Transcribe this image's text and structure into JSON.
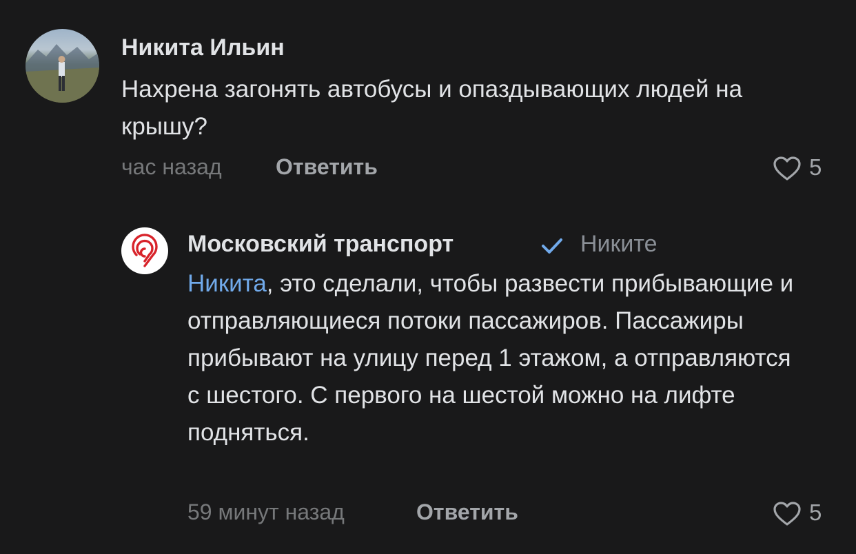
{
  "comments": [
    {
      "author": "Никита Ильин",
      "text": "Нахрена загонять автобусы и опаздывающих людей на крышу?",
      "time": "час назад",
      "reply_label": "Ответить",
      "likes": "5"
    },
    {
      "author": "Московский транспорт",
      "verified": true,
      "reply_to": "Никите",
      "mention": "Никита",
      "text": ", это сделали, чтобы развести прибывающие и отправляющиеся потоки пассажиров. Пассажиры прибывают на улицу перед 1 этажом, а отправляются с шестого. С первого на шестой можно на лифте подняться.",
      "time": "59 минут назад",
      "reply_label": "Ответить",
      "likes": "5"
    }
  ],
  "icons": {
    "verified": "check-icon",
    "like": "heart-outline-icon",
    "brand_logo": "moscow-transport-logo"
  },
  "colors": {
    "background": "#19191a",
    "text": "#e1e3e6",
    "secondary": "#76787a",
    "accent": "#71aaeb",
    "brand": "#d8232a"
  }
}
